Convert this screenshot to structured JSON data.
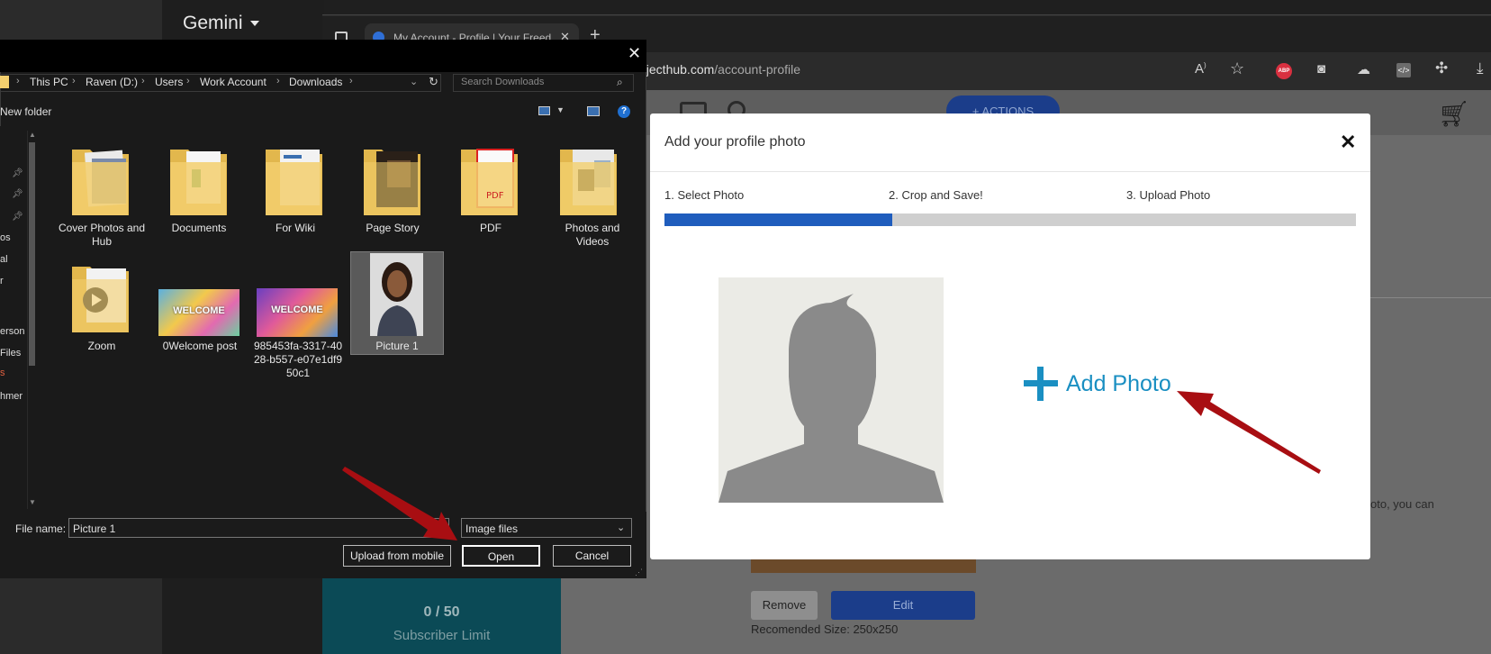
{
  "gemini": {
    "title": "Gemini"
  },
  "browser": {
    "tab_title": "My Account - Profile | Your Freed",
    "url_host": "ojecthub.com",
    "url_path": "/account-profile",
    "abp_label": "ABP"
  },
  "page": {
    "actions_label": "ACTIONS",
    "side_text": "oto, you can",
    "remove_label": "Remove",
    "edit_label": "Edit",
    "recommended_size": "Recomended Size: 250x250",
    "subscriber_count": "0 / 50",
    "subscriber_label": "Subscriber Limit"
  },
  "modal": {
    "title": "Add your profile photo",
    "steps": [
      "1. Select Photo",
      "2. Crop and Save!",
      "3. Upload Photo"
    ],
    "progress": 0.33,
    "add_photo_label": "Add Photo",
    "accent_color": "#1a8fc2"
  },
  "dialog": {
    "breadcrumbs": [
      "This PC",
      "Raven (D:)",
      "Users",
      "Work Account",
      "Downloads"
    ],
    "search_placeholder": "Search Downloads",
    "new_folder_label": "New folder",
    "nav_items": [
      "os",
      "al",
      "r",
      "erson",
      "Files",
      "s",
      "hmer"
    ],
    "items": [
      {
        "label": "Cover Photos and Hub",
        "kind": "folder"
      },
      {
        "label": "Documents",
        "kind": "folder"
      },
      {
        "label": "For Wiki",
        "kind": "folder"
      },
      {
        "label": "Page Story",
        "kind": "folder"
      },
      {
        "label": "PDF",
        "kind": "folder"
      },
      {
        "label": "Photos and Videos",
        "kind": "folder"
      },
      {
        "label": "Zoom",
        "kind": "folder"
      },
      {
        "label": "0Welcome post",
        "kind": "image"
      },
      {
        "label": "985453fa-3317-4028-b557-e07e1df950c1",
        "kind": "image"
      },
      {
        "label": "Picture 1",
        "kind": "image",
        "selected": true
      }
    ],
    "welcome_text": "WELCOME",
    "pdf_text": "PDF",
    "file_name_label": "File name:",
    "file_name_value": "Picture 1",
    "file_type": "Image files",
    "upload_mobile_label": "Upload from mobile",
    "open_label": "Open",
    "cancel_label": "Cancel"
  },
  "colors": {
    "arrow": "#a80e12",
    "progress_fill": "#1f5dbd",
    "folder": "#f3cf6e"
  }
}
